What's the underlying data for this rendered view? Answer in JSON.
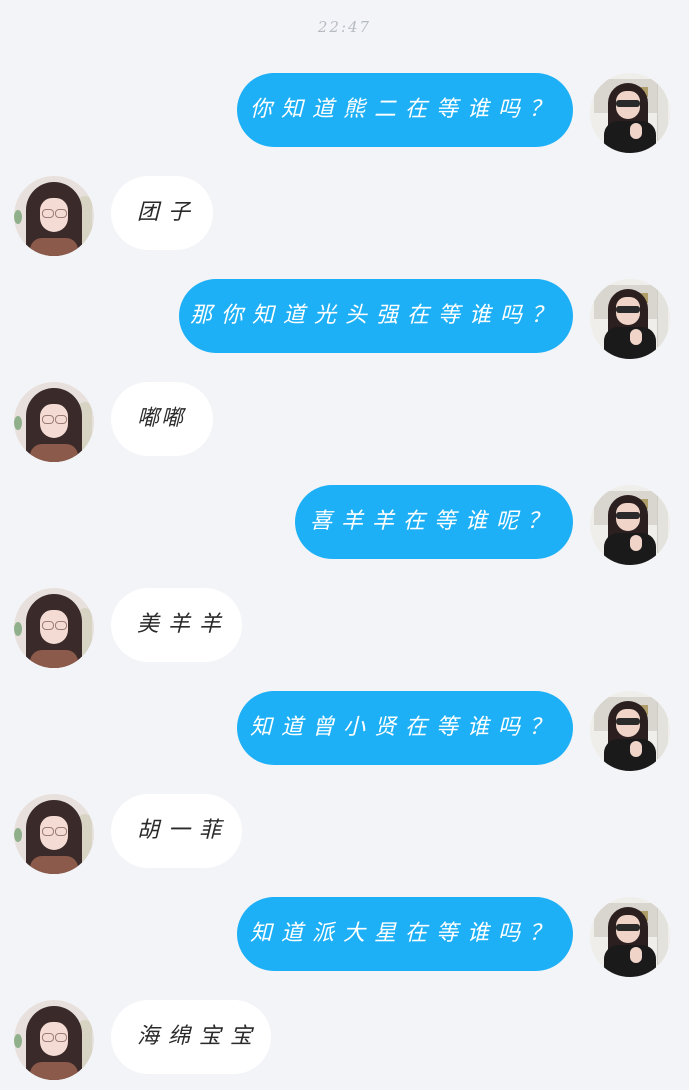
{
  "status": {
    "time": "22:47"
  },
  "messages": [
    {
      "side": "right",
      "text": "你知道熊二在等谁吗？"
    },
    {
      "side": "left",
      "text": "团子"
    },
    {
      "side": "right",
      "text": "那你知道光头强在等谁吗？"
    },
    {
      "side": "left",
      "text": "嘟嘟"
    },
    {
      "side": "right",
      "text": "喜羊羊在等谁呢？"
    },
    {
      "side": "left",
      "text": "美羊羊"
    },
    {
      "side": "right",
      "text": "知道曾小贤在等谁吗？"
    },
    {
      "side": "left",
      "text": "胡一菲"
    },
    {
      "side": "right",
      "text": "知道派大星在等谁吗？"
    },
    {
      "side": "left",
      "text": "海绵宝宝"
    }
  ],
  "colors": {
    "background": "#f3f4f7",
    "sent_bubble": "#1eb0f6",
    "received_bubble": "#ffffff"
  }
}
